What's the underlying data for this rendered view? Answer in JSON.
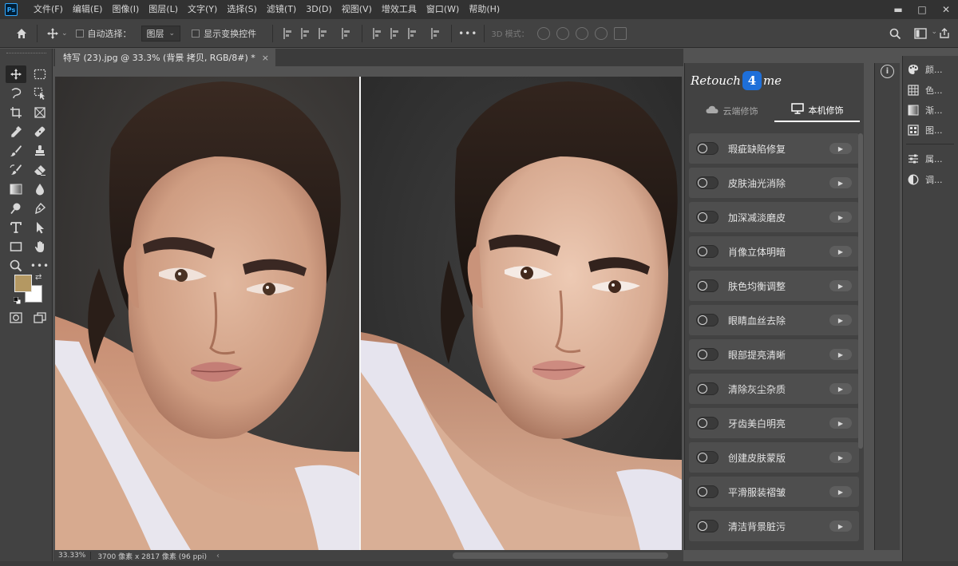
{
  "app": {
    "logo_text": "Ps"
  },
  "menu": [
    "文件(F)",
    "编辑(E)",
    "图像(I)",
    "图层(L)",
    "文字(Y)",
    "选择(S)",
    "滤镜(T)",
    "3D(D)",
    "视图(V)",
    "增效工具",
    "窗口(W)",
    "帮助(H)"
  ],
  "window_controls": {
    "minimize": "▬",
    "maximize": "□",
    "close": "✕"
  },
  "options_bar": {
    "auto_select_label": "自动选择：",
    "auto_select_value": "图层",
    "show_transform_label": "显示变换控件",
    "more_label": "•••",
    "mode_3d_label": "3D 模式："
  },
  "document": {
    "tab_title": "特写 (23).jpg @ 33.3% (背景 拷贝, RGB/8#) *",
    "close": "×"
  },
  "status_bar": {
    "zoom": "33.33%",
    "info": "3700 像素 x 2817 像素 (96 ppi)",
    "arrow": "‹"
  },
  "colors": {
    "foreground": "#b49862",
    "background": "#ffffff",
    "brand_blue": "#1e6fd9"
  },
  "plugin": {
    "logo_left": "Retouch",
    "logo_badge": "4",
    "logo_right": "me",
    "tabs": [
      {
        "label": "云端修饰",
        "icon": "cloud-icon",
        "active": false
      },
      {
        "label": "本机修饰",
        "icon": "monitor-icon",
        "active": true
      }
    ],
    "features": [
      "瑕疵缺陷修复",
      "皮肤油光消除",
      "加深减淡磨皮",
      "肖像立体明暗",
      "肤色均衡调整",
      "眼睛血丝去除",
      "眼部提亮清晰",
      "清除灰尘杂质",
      "牙齿美白明亮",
      "创建皮肤蒙版",
      "平滑服装褶皱",
      "清洁背景脏污"
    ]
  },
  "info_panel": {
    "icon": "i"
  },
  "side_panels": [
    {
      "label": "颜...",
      "icon": "palette-icon"
    },
    {
      "label": "色...",
      "icon": "swatches-icon"
    },
    {
      "label": "渐...",
      "icon": "gradient-icon"
    },
    {
      "label": "图...",
      "icon": "pattern-icon"
    },
    {
      "label": "属...",
      "icon": "properties-icon"
    },
    {
      "label": "调...",
      "icon": "adjustments-icon"
    }
  ]
}
